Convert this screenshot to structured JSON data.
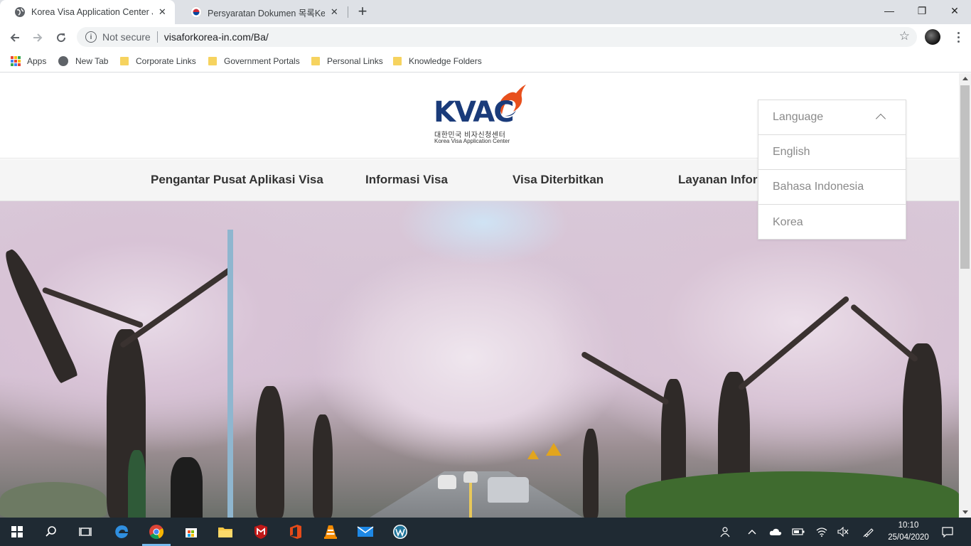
{
  "browser": {
    "tabs": [
      {
        "title": "Korea Visa Application Center Jak",
        "active": true
      },
      {
        "title": "Persyaratan Dokumen 목록Kedut",
        "active": false
      }
    ],
    "close_glyph": "✕",
    "new_tab_glyph": "+",
    "window_controls": {
      "minimize": "—",
      "restore": "❐",
      "close": "✕"
    },
    "security_label": "Not secure",
    "url": "visaforkorea-in.com/Ba/",
    "bookmarks": [
      {
        "label": "Apps",
        "icon": "apps-grid-icon"
      },
      {
        "label": "New Tab",
        "icon": "globe-icon"
      },
      {
        "label": "Corporate Links",
        "icon": "folder-icon"
      },
      {
        "label": "Government Portals",
        "icon": "folder-icon"
      },
      {
        "label": "Personal Links",
        "icon": "folder-icon"
      },
      {
        "label": "Knowledge Folders",
        "icon": "folder-icon"
      }
    ]
  },
  "site": {
    "logo": {
      "word": "KVAC",
      "korean": "대한민국 비자신청센터",
      "english": "Korea Visa Application Center"
    },
    "nav": [
      "Pengantar Pusat Aplikasi Visa",
      "Informasi Visa",
      "Visa Diterbitkan",
      "Layanan Inform"
    ],
    "language": {
      "label": "Language",
      "expanded": true,
      "options": [
        "English",
        "Bahasa Indonesia",
        "Korea"
      ]
    }
  },
  "taskbar": {
    "time": "10:10",
    "date": "25/04/2020"
  },
  "colors": {
    "brand_navy": "#1a3b7a",
    "brand_orange": "#e8501d",
    "taskbar": "#1f2a33"
  }
}
